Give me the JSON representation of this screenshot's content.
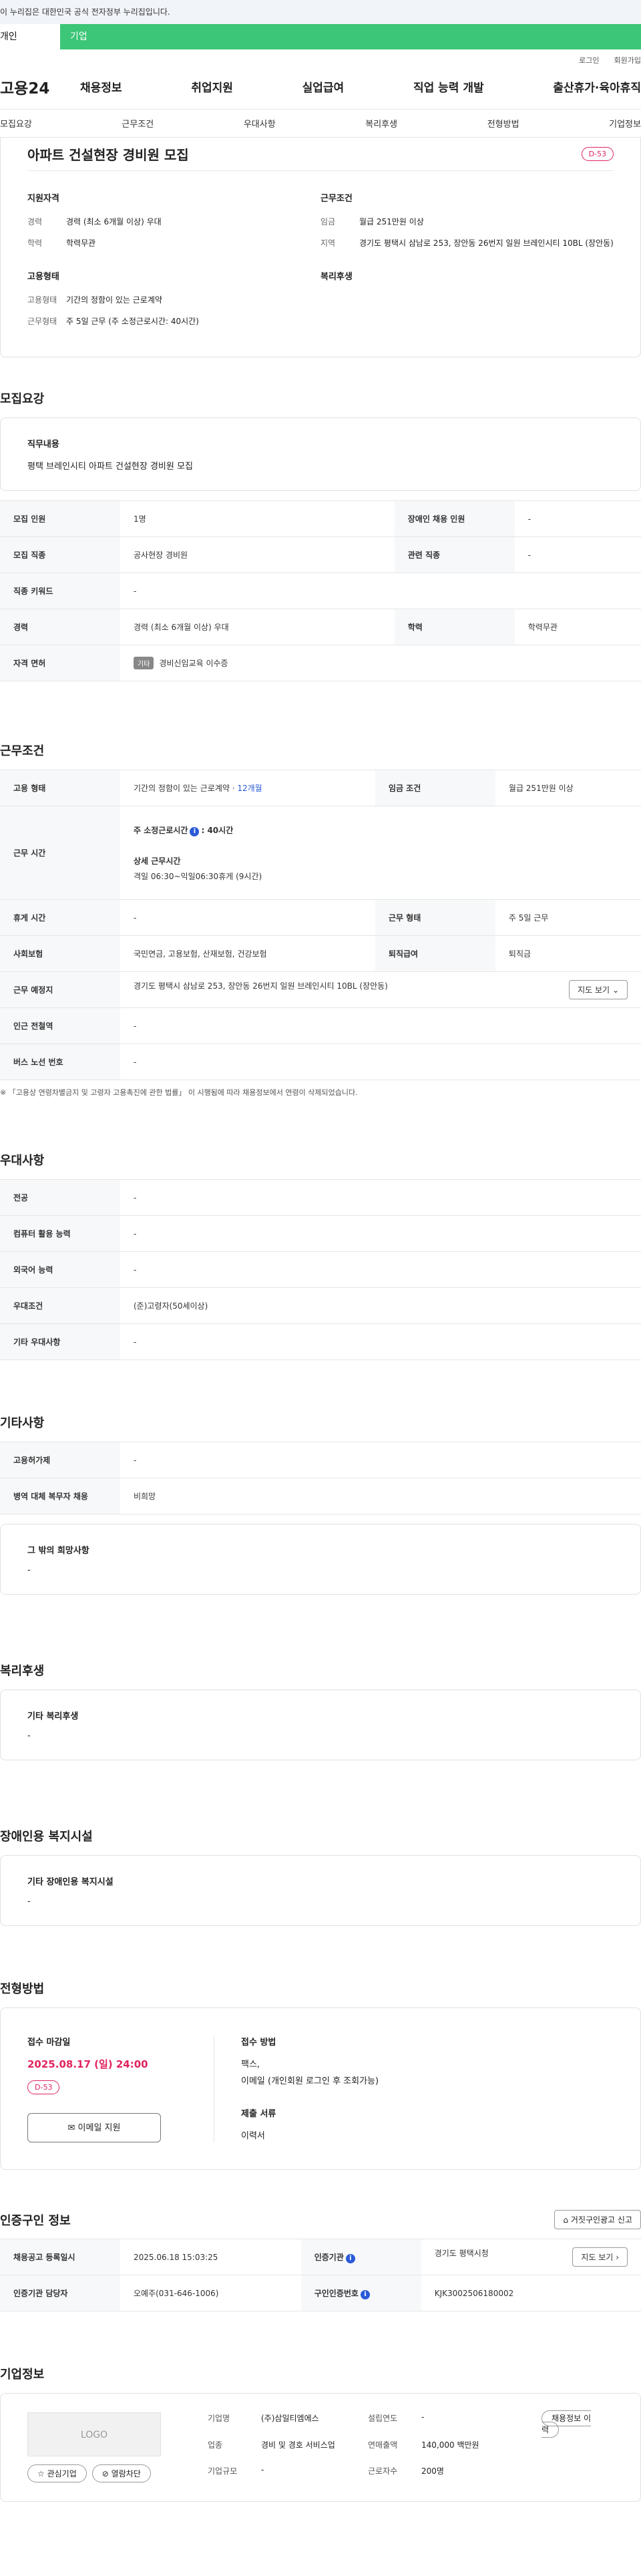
{
  "gov_bar": {
    "text": "이 누리집은 대한민국 공식 전자정부 누리집입니다."
  },
  "top_tabs": [
    "개인",
    "기업"
  ],
  "util_links": [
    "로그인",
    "회원가입"
  ],
  "logo": "고용24",
  "gnb": [
    "채용정보",
    "취업지원",
    "실업급여",
    "직업 능력 개발",
    "출산휴가·육아휴직"
  ],
  "sub_tabs": [
    "모집요강",
    "근무조건",
    "우대사항",
    "복리후생",
    "전형방법",
    "기업정보"
  ],
  "job": {
    "title": "아파트 건설현장 경비원 모집",
    "dday": "D-53",
    "summary": {
      "qual_title": "지원자격",
      "career_k": "경력",
      "career_v": "경력 (최소 6개월 이상) 우대",
      "edu_k": "학력",
      "edu_v": "학력무관",
      "emp_title": "고용형태",
      "emptype_k": "고용형태",
      "emptype_v": "기간의 정함이 있는 근로계약",
      "worktype_k": "근무형태",
      "worktype_v": "주 5일 근무 (주 소정근로시간: 40시간)",
      "cond_title": "근무조건",
      "wage_k": "임금",
      "wage_v": "월급 251만원 이상",
      "region_k": "지역",
      "region_v": "경기도 평택시 삼남로 253, 장안동 26번지 일원 브레인시티 10BL (장안동)",
      "welfare_title": "복리후생"
    }
  },
  "recruit": {
    "section": "모집요강",
    "duty_title": "직무내용",
    "duty_text": "평택 브레인시티 아파트 건설현장 경비원 모집",
    "rows": [
      {
        "k1": "모집 인원",
        "v1": "1명",
        "k2": "장애인 채용 인원",
        "v2": "-"
      },
      {
        "k1": "모집 직종",
        "v1": "공사현장 경비원",
        "k2": "관련 직종",
        "v2": "-"
      },
      {
        "k1": "직종 키워드",
        "v1": "-"
      },
      {
        "k1": "경력",
        "v1": "경력 (최소 6개월 이상) 우대",
        "k2": "학력",
        "v2": "학력무관"
      },
      {
        "k1": "자격 면허",
        "v1": "경비신임교육 이수증",
        "badge": "기타"
      }
    ]
  },
  "work": {
    "section": "근무조건",
    "emp_k": "고용 형태",
    "emp_v": "기간의 정함이 있는 근로계약 · ",
    "emp_link": "12개월",
    "wage_k": "임금 조건",
    "wage_v": "월급 251만원 이상",
    "time_k": "근무 시간",
    "time_main": "주 소정근로시간",
    "time_main_v": "40시간",
    "time_detail_t": "상세 근무시간",
    "time_detail_v": "격일 06:30~익일06:30휴게 (9시간)",
    "rest_k": "휴게 시간",
    "rest_v": "-",
    "form_k": "근무 형태",
    "form_v": "주 5일 근무",
    "ins_k": "사회보험",
    "ins_v": "국민연금, 고용보험, 산재보험, 건강보험",
    "ret_k": "퇴직급여",
    "ret_v": "퇴직금",
    "place_k": "근무 예정지",
    "place_v": "경기도 평택시 삼남로 253, 장안동 26번지 일원 브레인시티 10BL (장안동)",
    "map_btn": "지도 보기",
    "subway_k": "인근 전철역",
    "subway_v": "-",
    "bus_k": "버스 노선 번호",
    "bus_v": "-",
    "note": "※ 「고용상 연령차별금지 및 고령자 고용촉진에 관한 법률」 이 시행됨에 따라 채용정보에서 연령이 삭제되었습니다."
  },
  "pref": {
    "section": "우대사항",
    "rows": [
      {
        "k": "전공",
        "v": "-"
      },
      {
        "k": "컴퓨터 활용 능력",
        "v": "-"
      },
      {
        "k": "외국어 능력",
        "v": "-"
      },
      {
        "k": "우대조건",
        "v": "(준)고령자(50세이상)"
      },
      {
        "k": "기타 우대사항",
        "v": "-"
      }
    ]
  },
  "etc": {
    "section": "기타사항",
    "rows": [
      {
        "k": "고용허가제",
        "v": "-"
      },
      {
        "k": "병역 대체 복무자 채용",
        "v": "비희망"
      }
    ],
    "other_title": "그 밖의 희망사항",
    "other_v": "-"
  },
  "welfare": {
    "section": "복리후생",
    "title": "기타 복리후생",
    "v": "-"
  },
  "disabled": {
    "section": "장애인용 복지시설",
    "title": "기타 장애인용 복지시설",
    "v": "-"
  },
  "apply": {
    "section": "전형방법",
    "deadline_t": "접수 마감일",
    "deadline_v": "2025.08.17 (일) 24:00",
    "dday": "D-53",
    "email_btn": "이메일 지원",
    "method_t": "접수 방법",
    "method_v1": "팩스,",
    "method_v2": "이메일 (개인회원 로그인 후 조회가능)",
    "docs_t": "제출 서류",
    "docs_v": "이력서"
  },
  "cert": {
    "section": "인증구인 정보",
    "report_btn": "거짓구인광고 신고",
    "reg_k": "채용공고 등록일시",
    "reg_v": "2025.06.18 15:03:25",
    "org_k": "인증기관",
    "org_v": "경기도 평택시청",
    "map_btn": "지도 보기",
    "mgr_k": "인증기관 담당자",
    "mgr_v": "오예주(031-646-1006)",
    "no_k": "구인인증번호",
    "no_v": "KJK3002506180002"
  },
  "company": {
    "section": "기업정보",
    "logo_text": "LOGO",
    "fav_btn": "관심기업",
    "block_btn": "열람차단",
    "history_btn": "채용정보 이력",
    "name_k": "기업명",
    "name_v": "(주)삼일티엠에스",
    "year_k": "설립연도",
    "year_v": "-",
    "biz_k": "업종",
    "biz_v": "경비 및 경호 서비스업",
    "sales_k": "연매출액",
    "sales_v": "140,000 백만원",
    "size_k": "기업규모",
    "size_v": "-",
    "emp_k": "근로자수",
    "emp_v": "200명"
  }
}
